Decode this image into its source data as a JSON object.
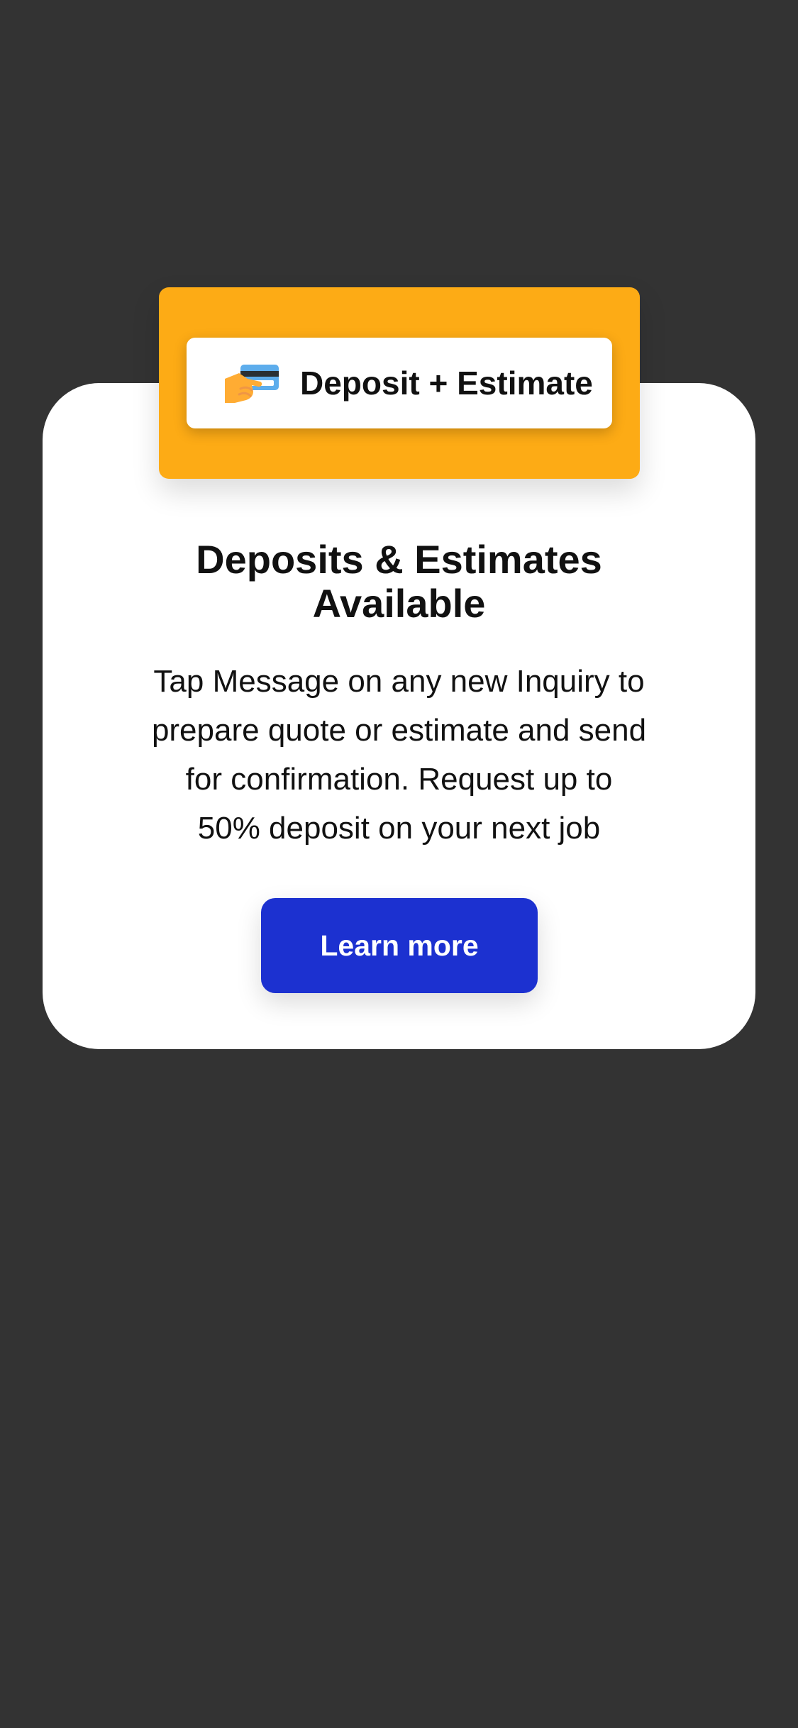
{
  "colors": {
    "background": "#333333",
    "card": "#ffffff",
    "banner": "#FDAB15",
    "button": "#1C31D0",
    "text": "#111111"
  },
  "badge": {
    "icon": "hand-with-credit-card-icon",
    "label": "Deposit + Estimate"
  },
  "card": {
    "title_lines": [
      "Deposits & Estimates",
      "Available"
    ],
    "description_lines": [
      "Tap Message on any new Inquiry to",
      "prepare quote or estimate and send",
      "for confirmation. Request up to",
      "50% deposit on your next job"
    ],
    "button_label": "Learn more"
  }
}
